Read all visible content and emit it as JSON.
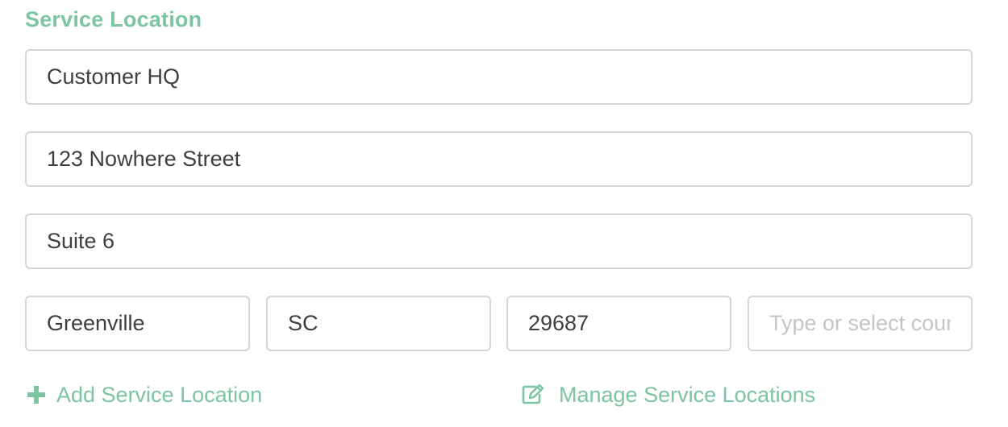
{
  "section": {
    "title": "Service Location"
  },
  "fields": {
    "location_name": {
      "value": "Customer HQ",
      "placeholder": ""
    },
    "address_line1": {
      "value": "123 Nowhere Street",
      "placeholder": ""
    },
    "address_line2": {
      "value": "Suite 6",
      "placeholder": ""
    },
    "city": {
      "value": "Greenville",
      "placeholder": ""
    },
    "state": {
      "value": "SC",
      "placeholder": ""
    },
    "zip": {
      "value": "29687",
      "placeholder": ""
    },
    "country": {
      "value": "",
      "placeholder": "Type or select country"
    }
  },
  "links": {
    "add": {
      "label": "Add Service Location",
      "icon": "plus-icon"
    },
    "manage": {
      "label": "Manage Service Locations",
      "icon": "edit-icon"
    }
  },
  "colors": {
    "accent": "#7cc4a2",
    "text": "#3d3f42",
    "border": "#d6d6d6",
    "placeholder": "#c3c5c8"
  }
}
